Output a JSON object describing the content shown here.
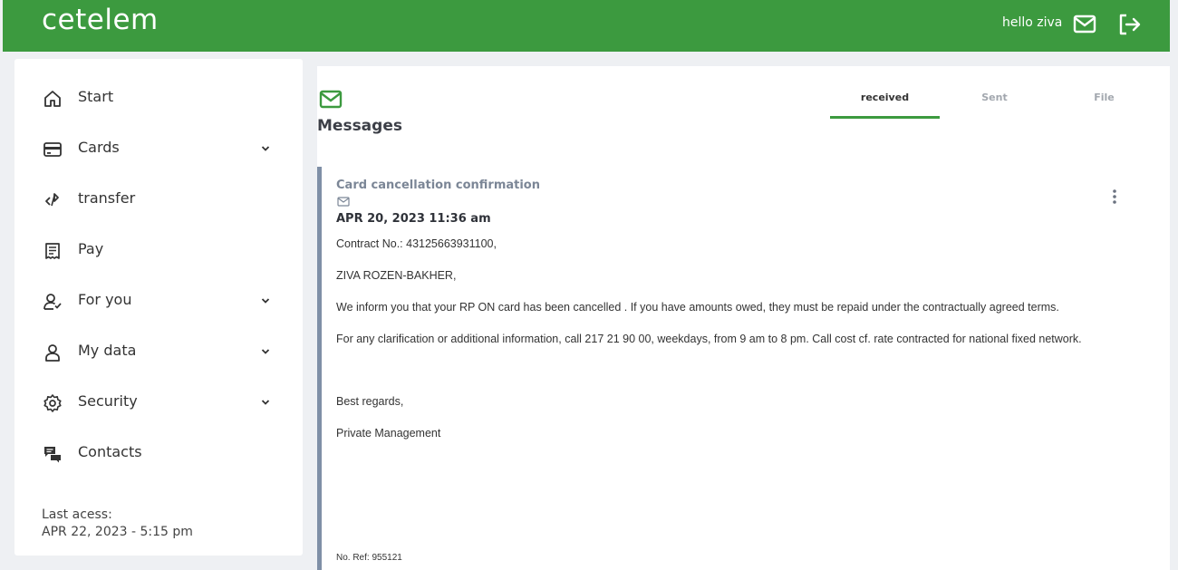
{
  "header": {
    "logo": "cetelem",
    "greeting": "hello ziva",
    "icons": [
      "mail-icon",
      "logout-icon"
    ],
    "bg_color": "#3c9a3f"
  },
  "sidebar": {
    "items": [
      {
        "label": "Start",
        "icon": "home-icon",
        "expandable": false
      },
      {
        "label": "Cards",
        "icon": "card-icon",
        "expandable": true
      },
      {
        "label": "transfer",
        "icon": "transfer-icon",
        "expandable": false
      },
      {
        "label": "Pay",
        "icon": "receipt-icon",
        "expandable": false
      },
      {
        "label": "For you",
        "icon": "user-check-icon",
        "expandable": true
      },
      {
        "label": "My data",
        "icon": "user-icon",
        "expandable": true
      },
      {
        "label": "Security",
        "icon": "gear-icon",
        "expandable": true
      },
      {
        "label": "Contacts",
        "icon": "chat-icon",
        "expandable": false
      }
    ],
    "last_access_label": "Last acess:",
    "last_access_value": "APR 22, 2023 - 5:15 pm"
  },
  "messages": {
    "title": "Messages",
    "tabs": [
      {
        "label": "received",
        "active": true
      },
      {
        "label": "Sent",
        "active": false
      },
      {
        "label": "File",
        "active": false
      }
    ],
    "current": {
      "subject": "Card cancellation confirmation",
      "date": "APR 20, 2023 11:36 am",
      "contract": "Contract No.: 43125663931100,",
      "recipient": "ZIVA ROZEN-BAKHER,",
      "body1": "We inform you that your RP ON card has been cancelled . If you have amounts owed, they must be repaid under the contractually agreed terms.",
      "body2": "For any clarification or additional information, call 217 21 90 00, weekdays, from 9 am to 8 pm. Call cost cf. rate contracted for national fixed network.",
      "closing": "Best regards,",
      "signature": "Private Management",
      "ref": "No. Ref: 955121"
    }
  }
}
